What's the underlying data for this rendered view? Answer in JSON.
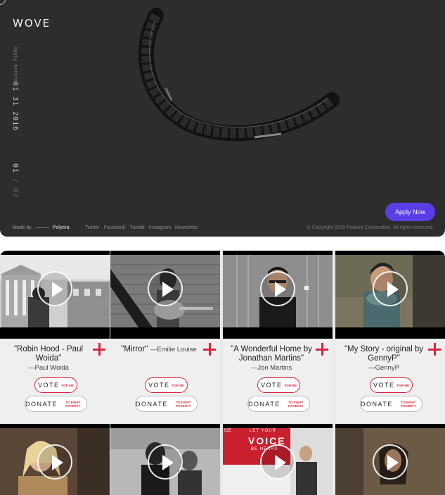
{
  "hero": {
    "logo": "WOVE",
    "apply_before": "Apply before",
    "date": "01 31 2016",
    "page_current": "01",
    "page_sep": "/",
    "page_total": "07",
    "made_by_label": "Made by",
    "made_by_brand": "Polyera",
    "social_links": [
      "Twitter",
      "Facebook",
      "Tumblr",
      "Instagram",
      "Newsletter"
    ],
    "copyright": "© Copyright 2015 Polyera Corporation. All rights reserved.",
    "apply_button": "Apply Now",
    "accent_color": "#5b3de6"
  },
  "vote_label": "VOTE",
  "vote_sub": "FOR ME",
  "donate_label": "DONATE",
  "donate_sub": "TO FIGHT POVERTY",
  "cards": [
    {
      "song": "\"Robin Hood - Paul Woida\"",
      "artist": "—Paul Woida"
    },
    {
      "song": "\"Mirror\"",
      "artist": "—Emilie Louise"
    },
    {
      "song": "\"A Wonderful Home by Jonathan Martins\"",
      "artist": "—Jon Martins"
    },
    {
      "song": "\"My Story - original by GennyP\"",
      "artist": "—GennyP"
    }
  ],
  "row2": {
    "banner_line1": "LET YOUR",
    "banner_line2": "VOICE",
    "banner_line3": "BE HEARD",
    "banner_brand": "ICE"
  },
  "colors": {
    "plus_red": "#d9263c"
  }
}
